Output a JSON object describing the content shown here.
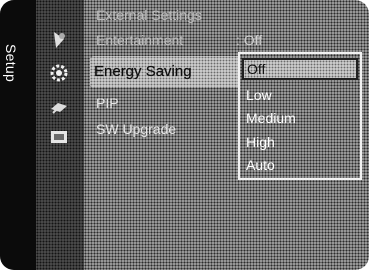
{
  "side_tab": {
    "label": "Setup"
  },
  "icons": [
    "picture-icon",
    "gear-icon",
    "satellite-icon",
    "media-icon"
  ],
  "menu": {
    "items": [
      {
        "label": "External Settings",
        "faded": true
      },
      {
        "label": "Entertainment",
        "value": ": Off",
        "faded": true
      },
      {
        "label": "Energy Saving",
        "selected": true
      },
      {
        "label": "PIP"
      },
      {
        "label": "SW Upgrade"
      }
    ]
  },
  "dropdown": {
    "options": [
      "Off",
      "Low",
      "Medium",
      "High",
      "Auto"
    ],
    "selected_value": "Off"
  }
}
